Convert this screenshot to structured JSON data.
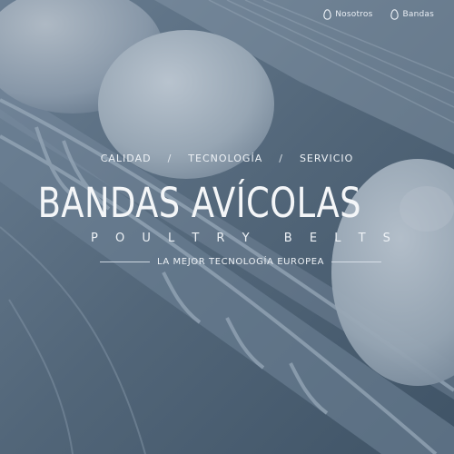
{
  "nav": {
    "items": [
      {
        "label": "Nosotros",
        "icon": "egg-icon"
      },
      {
        "label": "Bandas",
        "icon": "egg-icon"
      }
    ]
  },
  "hero": {
    "tagline": {
      "items": [
        "CALIDAD",
        "TECNOLOGÍA",
        "SERVICIO"
      ],
      "separator": "/"
    },
    "title": "BANDAS AVÍCOLAS",
    "subtitle_letters": [
      "P",
      "O",
      "U",
      "L",
      "T",
      "R",
      "Y",
      "",
      "B",
      "E",
      "L",
      "T",
      "S"
    ],
    "motto": "LA MEJOR TECNOLOGÍA EUROPEA"
  },
  "colors": {
    "overlay": "#4f6478",
    "text": "#f4f6f8"
  }
}
